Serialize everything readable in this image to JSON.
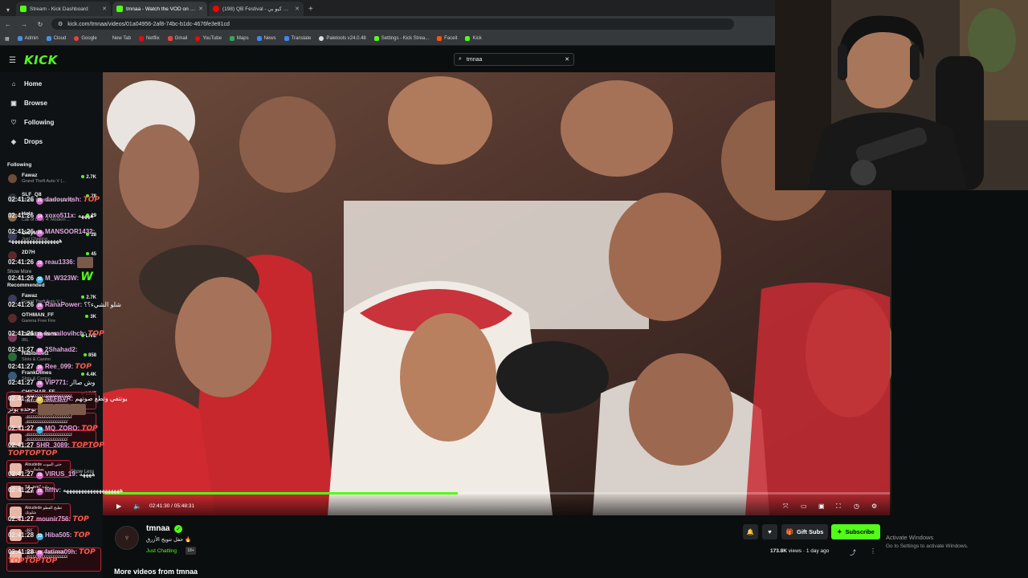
{
  "browser": {
    "tabs": [
      {
        "title": "Stream - Kick Dashboard",
        "active": false,
        "favicon": "kick"
      },
      {
        "title": "tmnaa - Watch the VOD on Kick",
        "active": true,
        "favicon": "kick"
      },
      {
        "title": "(198) QB Festival - مهرجان كيو بي",
        "active": false,
        "favicon": "youtube"
      }
    ],
    "url": "kick.com/tmnaa/videos/01a04956-2af8-74bc-b1dc-4676fe3e81cd",
    "bookmarks": [
      "Admin",
      "Cloud",
      "Google",
      "New Tab",
      "Netflix",
      "Gmail",
      "YouTube",
      "Maps",
      "News",
      "Translate",
      "Paletools v24.0.48",
      "Settings - Kick Strea...",
      "Faceit",
      "Kick"
    ]
  },
  "header": {
    "logo": "KICK",
    "search_value": "tmnaa"
  },
  "sidebar": {
    "nav": [
      {
        "label": "Home",
        "icon": "home-icon"
      },
      {
        "label": "Browse",
        "icon": "browse-icon"
      },
      {
        "label": "Following",
        "icon": "heart-icon"
      },
      {
        "label": "Drops",
        "icon": "drops-icon"
      }
    ],
    "following_title": "Following",
    "following": [
      {
        "name": "Fawaz",
        "game": "Grand Theft Auto V (...",
        "viewers": "2.7K"
      },
      {
        "name": "SLF_Q8",
        "game": "Grand Theft Auto V (GTA)",
        "viewers": "78"
      },
      {
        "name": "Holz",
        "game": "Call of Duty 4: Modern ...",
        "viewers": "29"
      },
      {
        "name": "OnlyMuh",
        "game": "Just Chatting",
        "viewers": "28"
      },
      {
        "name": "2D7H",
        "game": "",
        "viewers": "45"
      }
    ],
    "show_more": "Show More",
    "recommended_title": "Recommended",
    "recommended": [
      {
        "name": "Fawaz",
        "game": "Grand Theft Auto V (...",
        "viewers": "2.7K"
      },
      {
        "name": "OTHMAN_FF",
        "game": "Garena Free Fire",
        "viewers": "3K"
      },
      {
        "name": "CenkBeyRemi",
        "game": "IRL",
        "viewers": "LIVE"
      },
      {
        "name": "HabibiBetz",
        "game": "Slots & Casino",
        "viewers": "858"
      },
      {
        "name": "FrankDimes",
        "game": "Slots & Casino",
        "viewers": "4.4K"
      },
      {
        "name": "CHICHAR_FF",
        "game": "Garena Free Fire",
        "viewers": "LIVE"
      }
    ],
    "overlay_cards": [
      {
        "text": "ككككككككككككككككككككك ككككككككككككككككككك"
      },
      {
        "text": "ككككككككككككككككككككك ككككككككككككككككككك"
      },
      {
        "text": "ككككككككككككككككككككك ككككككككككككككككككك"
      },
      {
        "text": "Aloudede حتى الموت يسلمك ربي"
      },
      {
        "text": "SA_sva7 مادة اللعبة"
      },
      {
        "text": "Aloudede تطبخ الفطو شلونك"
      },
      {
        "text": "ككك"
      },
      {
        "text": "كككككككككككككككككك ككككككككككككككككككك"
      }
    ],
    "show_less": "Show Less"
  },
  "player": {
    "time_current": "02:41:30",
    "time_total": "05:48:31",
    "progress": 0.45
  },
  "channel": {
    "name": "tmnaa",
    "title": "حفل تتويج الأزرق 🔥",
    "category": "Just Chatting",
    "badge": "18+",
    "gift_label": "Gift Subs",
    "subscribe_label": "Subscribe",
    "views": "173.8K",
    "views_label": "views",
    "age": "1 day ago",
    "more_videos": "More videos from tmnaa"
  },
  "windows_notice": {
    "line1": "Activate Windows",
    "line2": "Go to Settings to activate Windows."
  },
  "chat": [
    {
      "ts": "02:41:26",
      "badge": "26",
      "user": "dadouvitsh:",
      "text": "",
      "emote": "TOP"
    },
    {
      "ts": "02:41:26",
      "badge": "14",
      "user": "xoxo511x:",
      "text": "ههههه",
      "emote": ""
    },
    {
      "ts": "02:41:26",
      "badge": "26",
      "user": "MANSOOR1432:",
      "text": "هههههههههههههههههه",
      "emote": ""
    },
    {
      "ts": "02:41:26",
      "badge": "26",
      "user": "reau1336:",
      "text": "",
      "emote": ""
    },
    {
      "ts": "02:41:26",
      "badge": "36",
      "user": "M_W323W:",
      "text": "",
      "emote": "W"
    },
    {
      "ts": "02:41:26",
      "badge": "26",
      "user": "RanaPower:",
      "text": "شلو الشيء؟؟",
      "emote": ""
    },
    {
      "ts": "02:41:26",
      "badge": "26",
      "user": "ismailovihch:",
      "text": "",
      "emote": "TOP"
    },
    {
      "ts": "02:41:27",
      "badge": "26",
      "user": "2Shahad2:",
      "text": "",
      "emote": ""
    },
    {
      "ts": "02:41:27",
      "badge": "26",
      "user": "Ree_099:",
      "text": "",
      "emote": "TOP"
    },
    {
      "ts": "02:41:27",
      "badge": "26",
      "user": "VIP771:",
      "text": "وش صاار",
      "emote": ""
    },
    {
      "ts": "02:41:27",
      "badge": "17",
      "user": "SEFBVR:",
      "text": "يونتفي وتطع صوتهم بوحده يوتر",
      "emote": ""
    },
    {
      "ts": "02:41:27",
      "badge": "34",
      "user": "MQ_ZORO:",
      "text": "",
      "emote": "TOP"
    },
    {
      "ts": "02:41:27",
      "badge": "",
      "user": "SHR_3089:",
      "text": "",
      "emote": "TOPTOP TOPTOPTOP"
    },
    {
      "ts": "02:41:27",
      "badge": "26",
      "user": "VIRUS_19:",
      "text": "ههههه",
      "emote": ""
    },
    {
      "ts": "02:41:27",
      "badge": "26",
      "user": "hfftv:",
      "text": "هههههههههههههههههههه",
      "emote": ""
    },
    {
      "ts": "02:41:27",
      "badge": "",
      "user": "mounir756:",
      "text": "",
      "emote": "TOP"
    },
    {
      "ts": "02:41:28",
      "badge": "33",
      "user": "Hiba505:",
      "text": "",
      "emote": "TOP"
    },
    {
      "ts": "02:41:28",
      "badge": "26",
      "user": "fatima09h:",
      "text": "",
      "emote": "TOP TOPTOPTOP"
    }
  ]
}
